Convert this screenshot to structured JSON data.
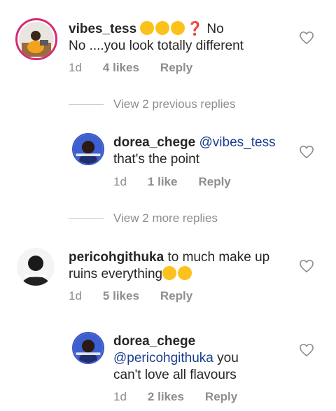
{
  "comments": [
    {
      "username": "vibes_tess",
      "text_prefix": "❓ No",
      "text": "No ....you look totally different",
      "emojis": [
        "flushed-face",
        "flushed-face",
        "flushed-face"
      ],
      "time": "1d",
      "likes": "4 likes",
      "reply": "Reply"
    },
    {
      "username": "dorea_chege",
      "mention": "@vibes_tess",
      "text": "that's the point",
      "time": "1d",
      "likes": "1 like",
      "reply": "Reply"
    },
    {
      "username": "pericohgithuka",
      "text": "to much make up",
      "text2": "ruins everything",
      "emojis": [
        "tears-of-joy",
        "tears-of-joy"
      ],
      "time": "1d",
      "likes": "5 likes",
      "reply": "Reply"
    },
    {
      "username": "dorea_chege",
      "mention": "@pericohgithuka",
      "text": "you",
      "text2": "can't love all flavours",
      "time": "1d",
      "likes": "2 likes",
      "reply": "Reply"
    }
  ],
  "view_previous": "View 2 previous replies",
  "view_more": "View 2 more replies",
  "colors": {
    "mention": "#1a3f8f",
    "meta": "#8e8e8e",
    "ring": "#e1306c"
  },
  "icons": [
    "heart-icon"
  ]
}
